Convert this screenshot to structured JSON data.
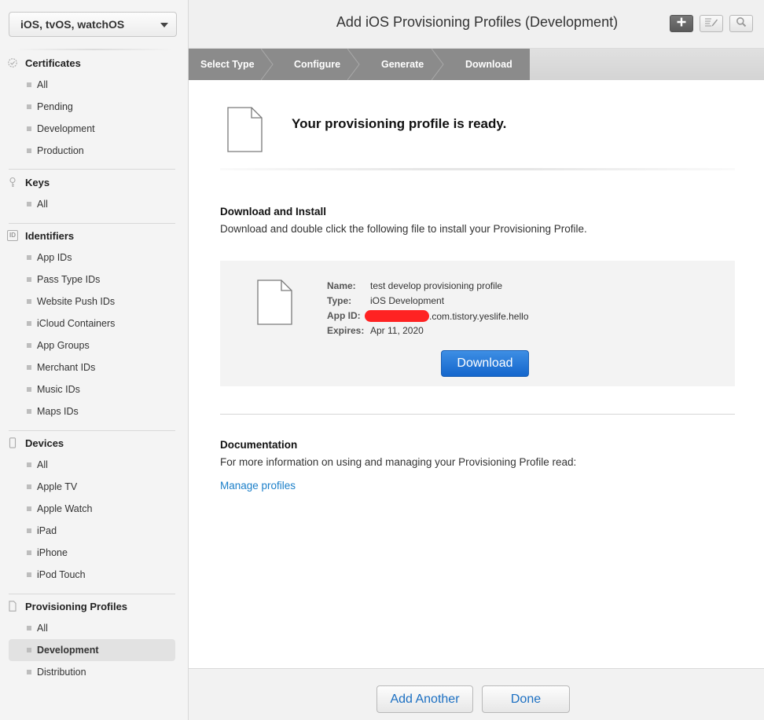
{
  "sidebar": {
    "platform": "iOS, tvOS, watchOS",
    "sections": {
      "certificates": {
        "title": "Certificates",
        "items": [
          "All",
          "Pending",
          "Development",
          "Production"
        ]
      },
      "keys": {
        "title": "Keys",
        "items": [
          "All"
        ]
      },
      "identifiers": {
        "title": "Identifiers",
        "icon_text": "ID",
        "items": [
          "App IDs",
          "Pass Type IDs",
          "Website Push IDs",
          "iCloud Containers",
          "App Groups",
          "Merchant IDs",
          "Music IDs",
          "Maps IDs"
        ]
      },
      "devices": {
        "title": "Devices",
        "items": [
          "All",
          "Apple TV",
          "Apple Watch",
          "iPad",
          "iPhone",
          "iPod Touch"
        ]
      },
      "profiles": {
        "title": "Provisioning Profiles",
        "items": [
          "All",
          "Development",
          "Distribution"
        ],
        "active": "Development"
      }
    }
  },
  "header": {
    "title": "Add iOS Provisioning Profiles (Development)",
    "buttons": [
      "add-icon",
      "edit-icon",
      "search-icon"
    ]
  },
  "steps": [
    "Select Type",
    "Configure",
    "Generate",
    "Download"
  ],
  "main": {
    "ready_text": "Your provisioning profile is ready.",
    "download_heading": "Download and Install",
    "download_text": "Download and double click the following file to install your Provisioning Profile.",
    "profile": {
      "name_label": "Name:",
      "name": "test develop provisioning profile",
      "type_label": "Type:",
      "type": "iOS Development",
      "app_id_label": "App ID:",
      "app_id_suffix": ".com.tistory.yeslife.hello",
      "expires_label": "Expires:",
      "expires": "Apr 11, 2020"
    },
    "download_button": "Download",
    "doc_heading": "Documentation",
    "doc_text": "For more information on using and managing your Provisioning Profile read:",
    "doc_link": "Manage profiles"
  },
  "footer": {
    "add_another": "Add Another",
    "done": "Done"
  },
  "colors": {
    "accent_blue": "#1466cc",
    "link_blue": "#1b7fc9",
    "steps_dark": "#8b8b8b",
    "redaction": "#ff2222"
  }
}
